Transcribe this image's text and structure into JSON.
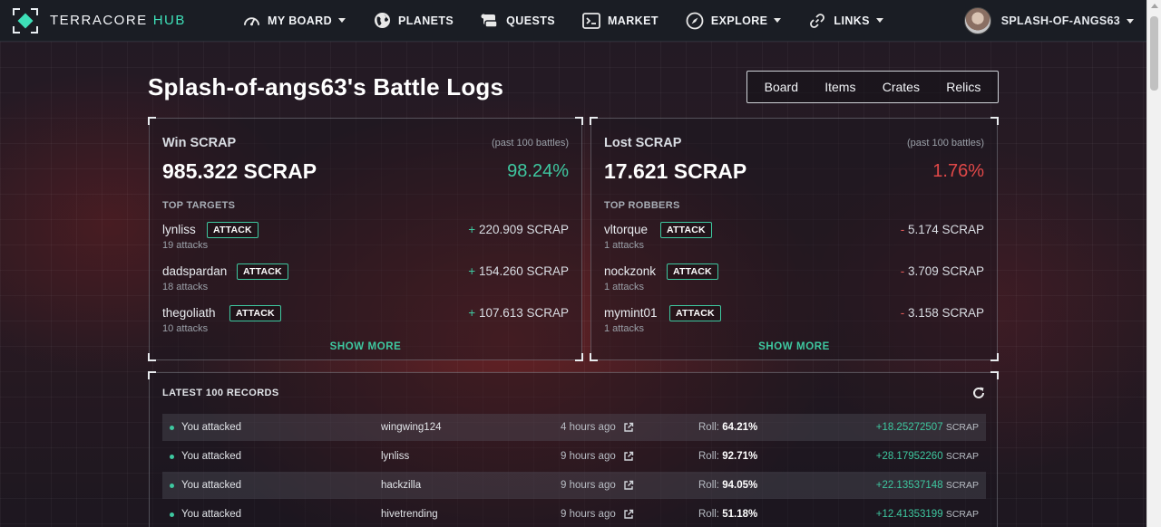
{
  "nav": {
    "brand_main": "TERRACORE",
    "brand_accent": "HUB",
    "items": [
      {
        "label": "MY BOARD",
        "icon": "dashboard-gauge-icon",
        "dropdown": true
      },
      {
        "label": "PLANETS",
        "icon": "globe-icon",
        "dropdown": false
      },
      {
        "label": "QUESTS",
        "icon": "scroll-icon",
        "dropdown": false
      },
      {
        "label": "MARKET",
        "icon": "terminal-icon",
        "dropdown": false
      },
      {
        "label": "EXPLORE",
        "icon": "compass-icon",
        "dropdown": true
      },
      {
        "label": "LINKS",
        "icon": "link-icon",
        "dropdown": true
      }
    ],
    "username": "SPLASH-OF-ANGS63"
  },
  "page": {
    "title": "Splash-of-angs63's Battle Logs",
    "tabs": [
      "Board",
      "Items",
      "Crates",
      "Relics"
    ]
  },
  "win": {
    "heading": "Win SCRAP",
    "period": "(past 100 battles)",
    "total": "985.322 SCRAP",
    "percent": "98.24%",
    "list_label": "TOP TARGETS",
    "entries": [
      {
        "name": "lynliss",
        "attack": "ATTACK",
        "attacks": "19 attacks",
        "sign": "+",
        "amount": "220.909 SCRAP"
      },
      {
        "name": "dadspardan",
        "attack": "ATTACK",
        "attacks": "18 attacks",
        "sign": "+",
        "amount": "154.260 SCRAP"
      },
      {
        "name": "thegoliath",
        "attack": "ATTACK",
        "attacks": "10 attacks",
        "sign": "+",
        "amount": "107.613 SCRAP"
      }
    ],
    "show_more": "SHOW MORE"
  },
  "lost": {
    "heading": "Lost SCRAP",
    "period": "(past 100 battles)",
    "total": "17.621 SCRAP",
    "percent": "1.76%",
    "list_label": "TOP ROBBERS",
    "entries": [
      {
        "name": "vltorque",
        "attack": "ATTACK",
        "attacks": "1 attacks",
        "sign": "-",
        "amount": "5.174 SCRAP"
      },
      {
        "name": "nockzonk",
        "attack": "ATTACK",
        "attacks": "1 attacks",
        "sign": "-",
        "amount": "3.709 SCRAP"
      },
      {
        "name": "mymint01",
        "attack": "ATTACK",
        "attacks": "1 attacks",
        "sign": "-",
        "amount": "3.158 SCRAP"
      }
    ],
    "show_more": "SHOW MORE"
  },
  "records": {
    "title": "LATEST 100 RECORDS",
    "roll_label": "Roll:",
    "rows": [
      {
        "action": "You attacked",
        "user": "wingwing124",
        "time": "4 hours ago",
        "roll": "64.21%",
        "amount": "+18.25272507",
        "unit": "SCRAP"
      },
      {
        "action": "You attacked",
        "user": "lynliss",
        "time": "9 hours ago",
        "roll": "92.71%",
        "amount": "+28.17952260",
        "unit": "SCRAP"
      },
      {
        "action": "You attacked",
        "user": "hackzilla",
        "time": "9 hours ago",
        "roll": "94.05%",
        "amount": "+22.13537148",
        "unit": "SCRAP"
      },
      {
        "action": "You attacked",
        "user": "hivetrending",
        "time": "9 hours ago",
        "roll": "51.18%",
        "amount": "+12.41353199",
        "unit": "SCRAP"
      }
    ]
  },
  "colors": {
    "accent": "#3ee0b8",
    "green": "#3ec8a0",
    "red": "#e04848"
  }
}
